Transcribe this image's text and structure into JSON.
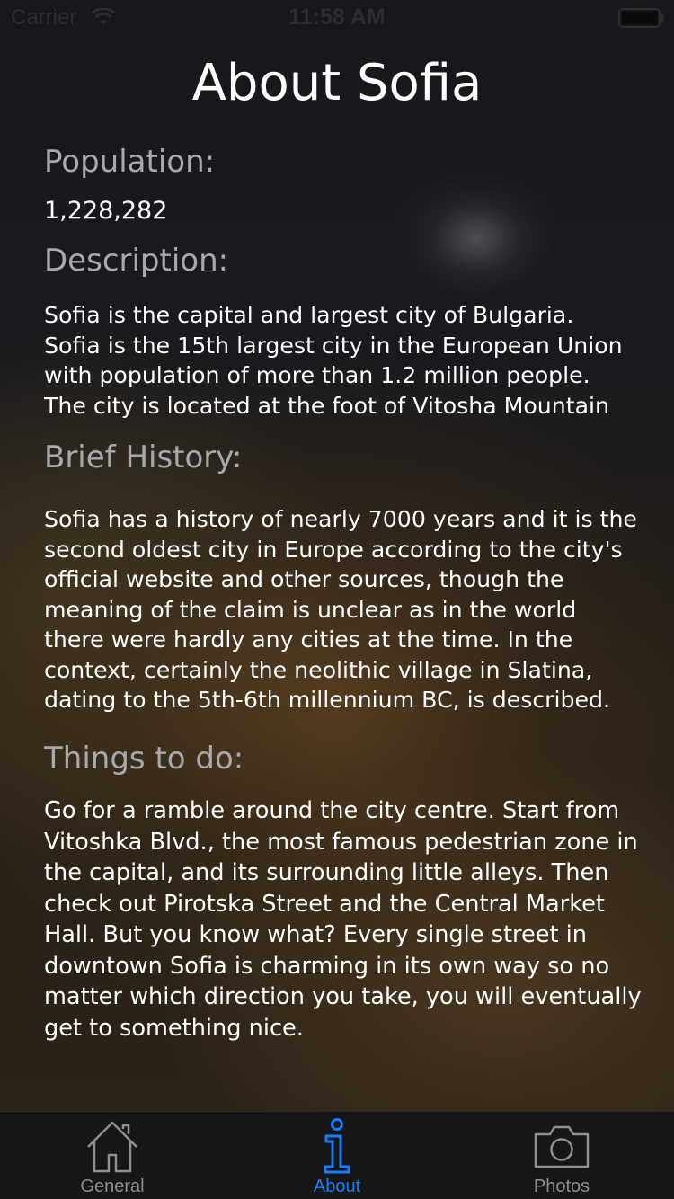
{
  "status_bar": {
    "carrier": "Carrier",
    "time": "11:58 AM"
  },
  "page": {
    "title": "About Sofia"
  },
  "population": {
    "label": "Population:",
    "value": "1,228,282"
  },
  "description": {
    "label": "Description:",
    "text": "Sofia is the capital and largest city of Bulgaria. Sofia is the 15th largest city in the European Union with population of more than 1.2 million people. The city is located at the foot of Vitosha Mountain"
  },
  "history": {
    "label": "Brief History:",
    "text": "Sofia has a history of nearly 7000 years and it is the second oldest city in Europe according to the city's official website and other sources, though the meaning of the claim is unclear as in the world there were hardly any cities at the time. In the context, certainly the neolithic village in Slatina, dating to the 5th-6th millennium BC, is described."
  },
  "things_to_do": {
    "label": "Things to do:",
    "text": "Go for a ramble around the city centre. Start from Vitoshka Blvd., the most famous pedestrian zone in the capital, and its surrounding little alleys. Then check out Pirotska Street and the Central Market Hall. But you know what? Every single street in downtown Sofia is charming in its own way so no matter which direction you take, you will eventually get to something nice."
  },
  "tab_bar": {
    "tabs": [
      {
        "label": "General",
        "icon": "house-icon"
      },
      {
        "label": "About",
        "icon": "info-icon",
        "active": true
      },
      {
        "label": "Photos",
        "icon": "camera-icon"
      }
    ],
    "active_color": "#157efb",
    "inactive_color": "#8e8e93"
  }
}
